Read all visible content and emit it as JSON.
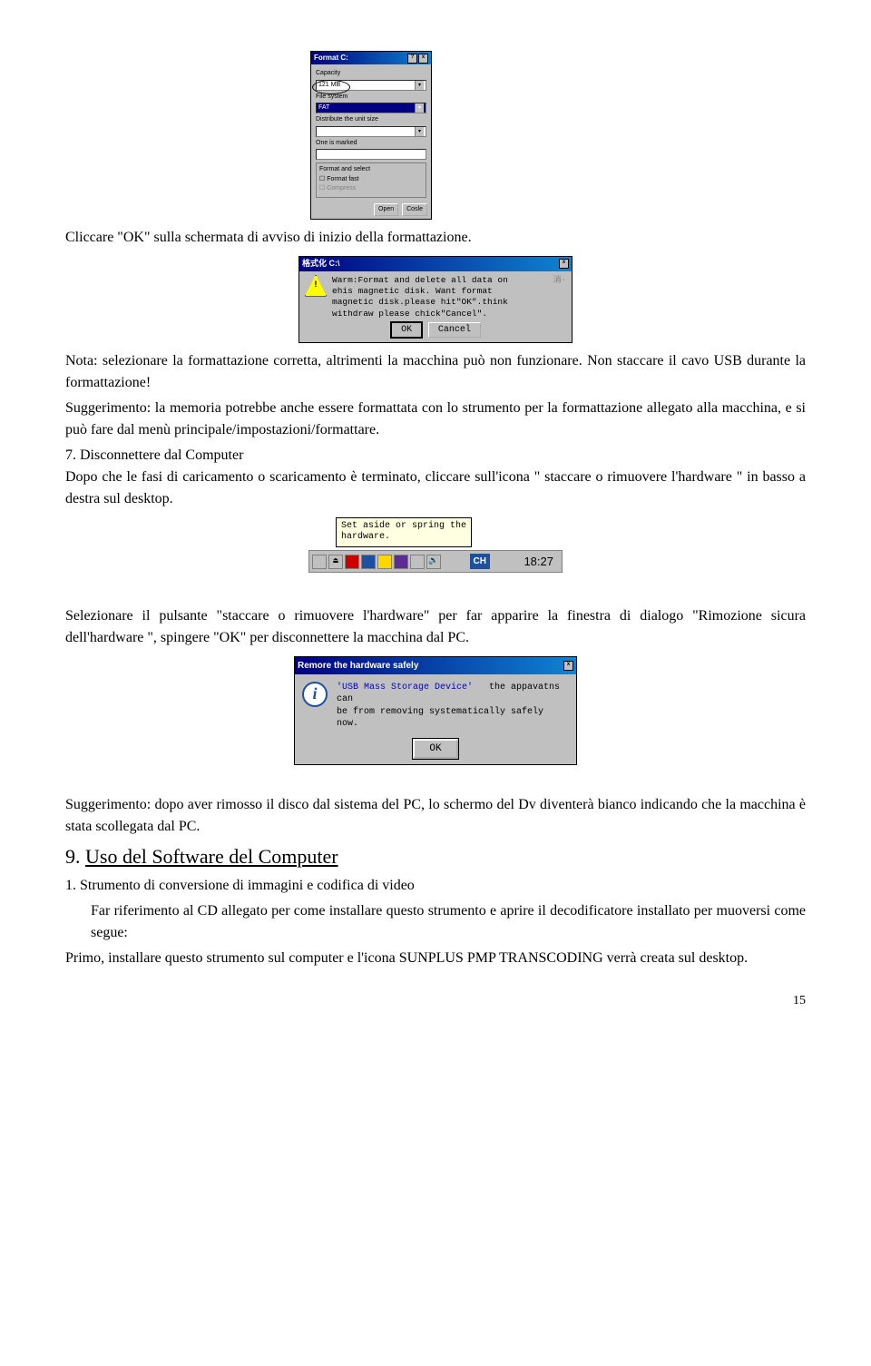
{
  "dlg1": {
    "title": "Format C:",
    "capacity_label": "Capacity",
    "capacity_value": "121 MB",
    "fs_label": "File system",
    "fs_value": "FAT",
    "unit_label": "Distribute the unit size",
    "unit_value": "",
    "marked_label": "One is marked",
    "marked_value": "",
    "group_label": "Format and select",
    "check1": "Format fast",
    "check2": "Compress",
    "btn_open": "Open",
    "btn_close": "Cosle"
  },
  "para1": "Cliccare \"OK\" sulla schermata di avviso di inizio della formattazione.",
  "dlg2": {
    "title": "格式化 C:\\",
    "line1": "Warm:Format and delete all data on",
    "line2": "ehis magnetic disk. Want format",
    "line3": "magnetic disk.please hit\"OK\".think",
    "line4": "withdraw please chick\"Cancel\".",
    "side": "消·",
    "btn_ok": "OK",
    "btn_cancel": "Cancel"
  },
  "para2a": "Nota: selezionare la formattazione corretta, altrimenti la macchina può non funzionare. Non staccare il cavo USB durante la formattazione!",
  "para2b": "Suggerimento: la memoria potrebbe anche essere formattata con lo strumento per la formattazione allegato alla macchina, e si può fare dal menù principale/impostazioni/formattare.",
  "sec7_title": "7. Disconnettere dal Computer",
  "sec7_body": "Dopo che le fasi di caricamento o scaricamento è terminato, cliccare sull'icona \" staccare o rimuovere l'hardware \" in basso a destra sul desktop.",
  "tray": {
    "tip_l1": "Set aside or spring the",
    "tip_l2": "hardware.",
    "lang": "CH",
    "time": "18:27"
  },
  "para3": "Selezionare il pulsante \"staccare o rimuovere l'hardware\" per far apparire la finestra di dialogo \"Rimozione sicura dell'hardware \", spingere \"OK\" per disconnettere la macchina dal PC.",
  "dlg4": {
    "title": "Remore the hardware safely",
    "l1a": "'USB Mass Storage Device'",
    "l1b": "the appavatns can",
    "l2": "be from removing systematically safely now.",
    "btn_ok": "OK"
  },
  "para4": " Suggerimento: dopo aver rimosso il disco dal sistema del PC, lo schermo del Dv diventerà bianco indicando che la macchina è stata scollegata dal PC.",
  "sec9_num": "9. ",
  "sec9_title": "Uso del Software del Computer",
  "sec9_sub": "1. Strumento di conversione di immagini e codifica di video",
  "sec9_p1": "Far riferimento al CD allegato per come installare questo strumento e aprire il decodificatore installato per muoversi come segue:",
  "sec9_p2": "Primo, installare questo strumento sul computer e l'icona SUNPLUS PMP TRANSCODING verrà creata sul desktop.",
  "page_num": "15"
}
